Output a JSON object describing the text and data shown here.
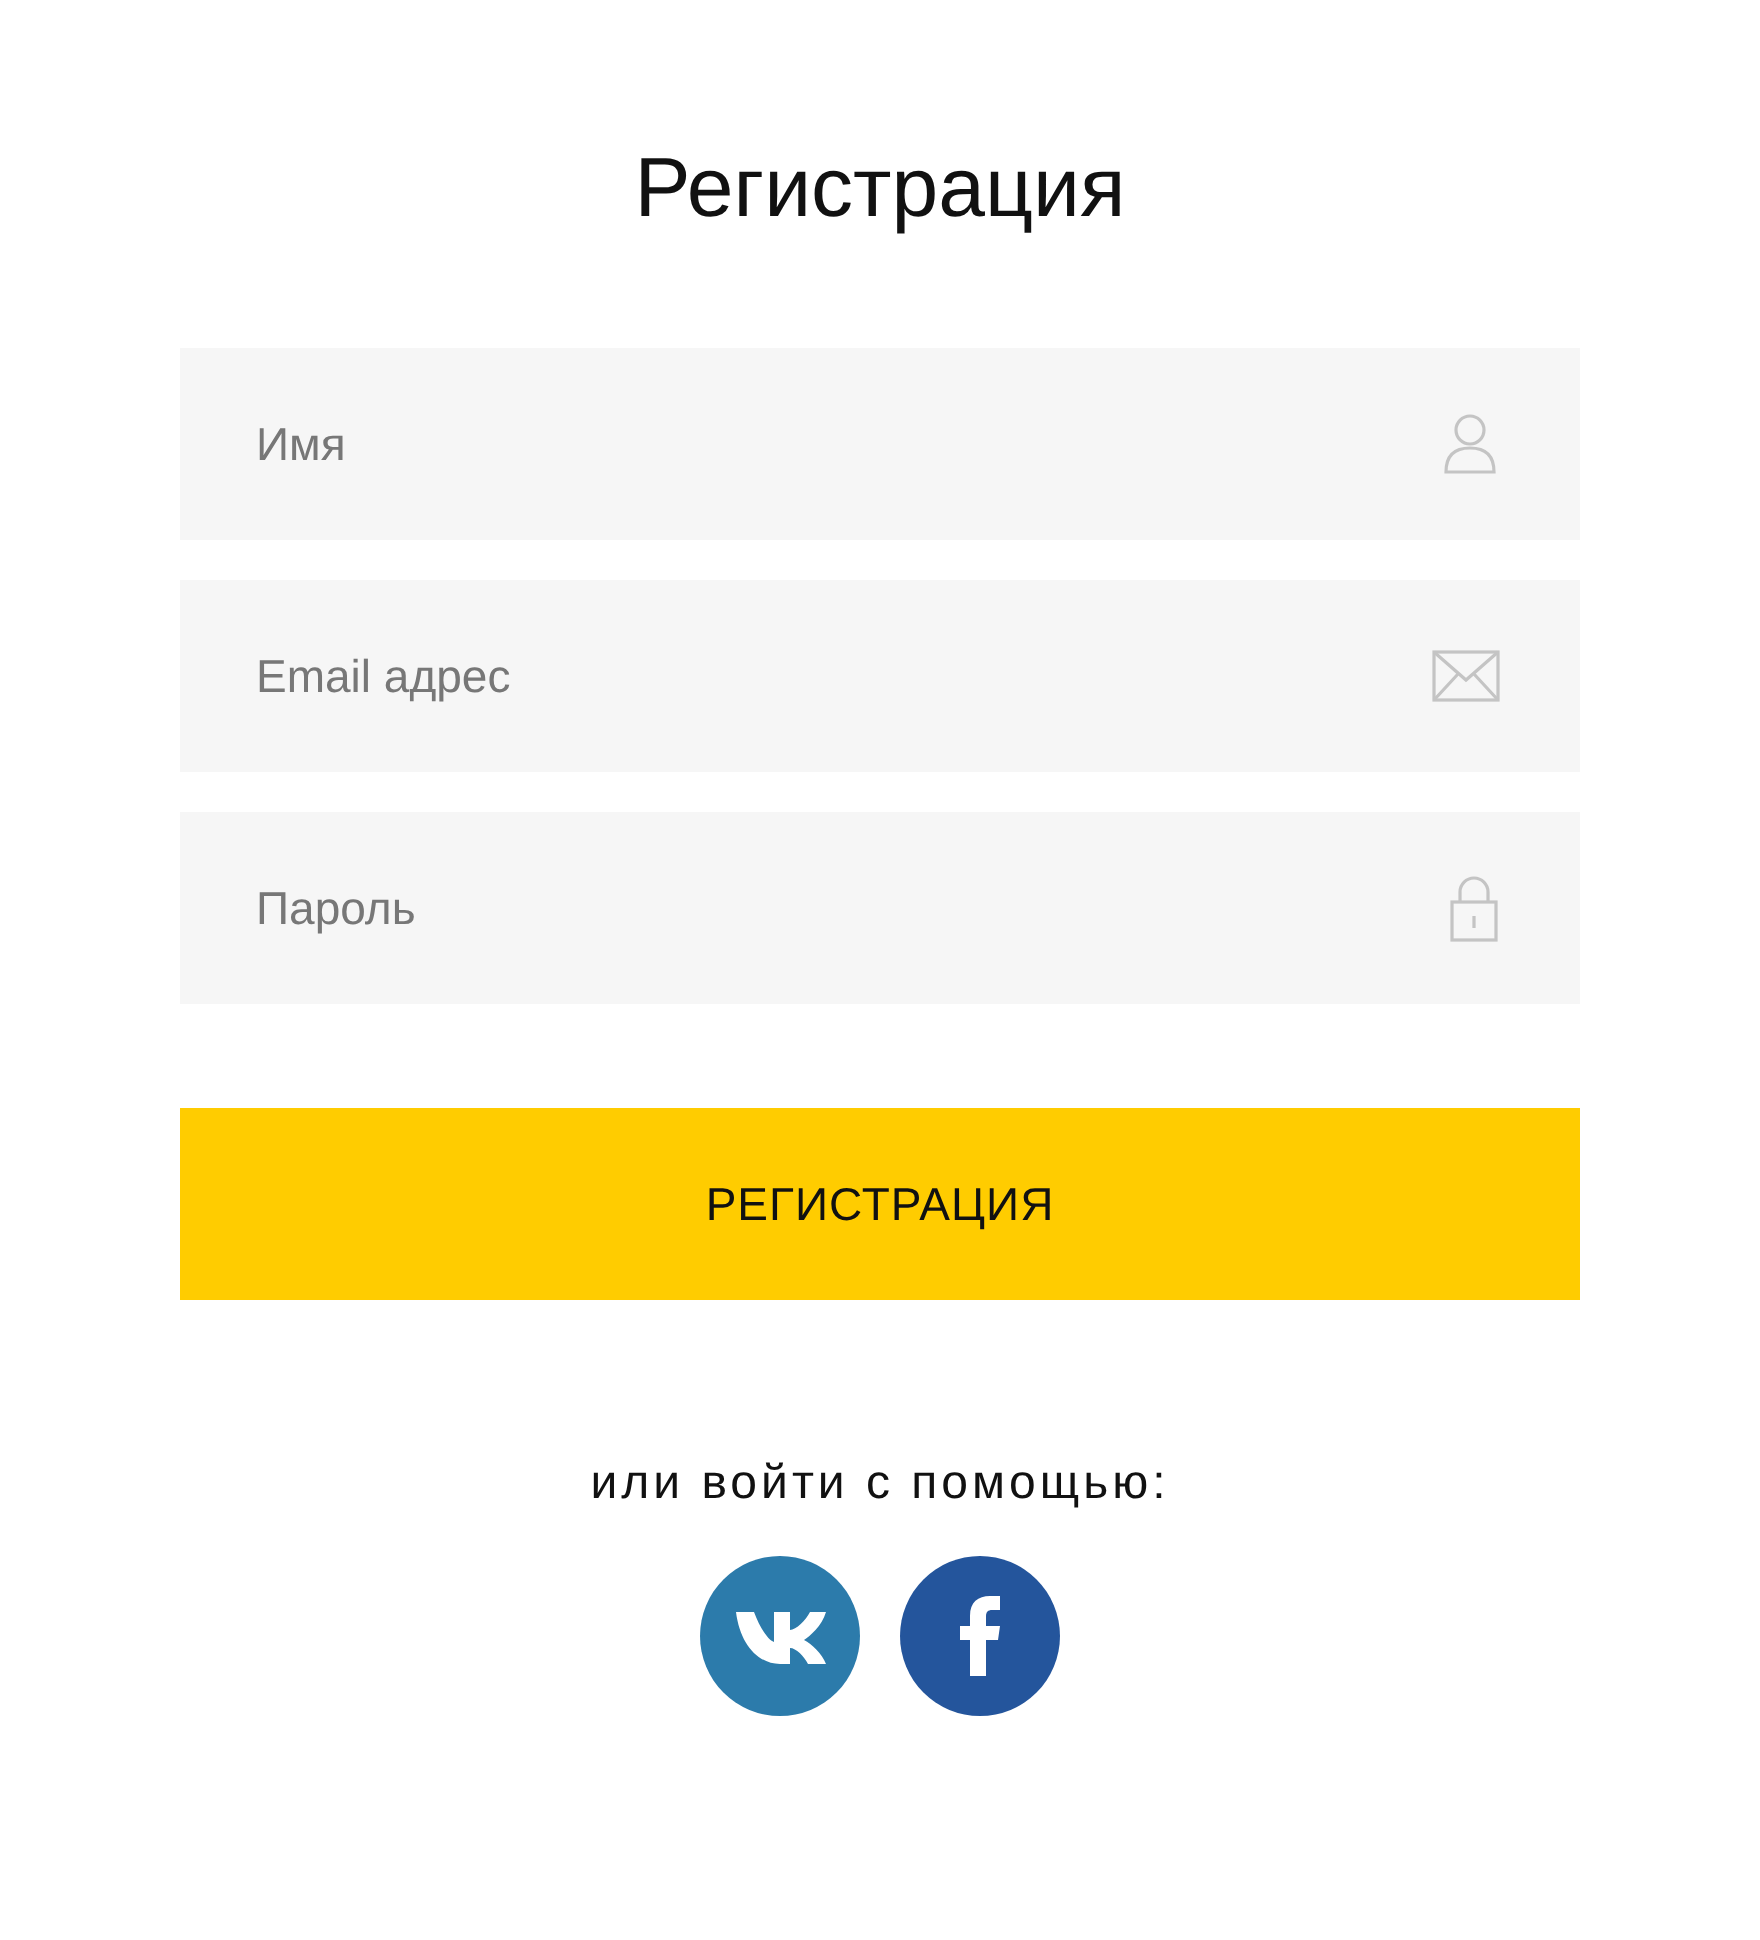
{
  "title": "Регистрация",
  "fields": [
    {
      "placeholder": "Имя",
      "kind": "user"
    },
    {
      "placeholder": "Email адрес",
      "kind": "mail"
    },
    {
      "placeholder": "Пароль",
      "kind": "lock"
    }
  ],
  "submit": "РЕГИСТРАЦИЯ",
  "alt_login": "или войти с помощью:",
  "social": [
    {
      "kind": "vk",
      "color": "#2c7bab"
    },
    {
      "kind": "facebook",
      "color": "#24559c"
    }
  ]
}
